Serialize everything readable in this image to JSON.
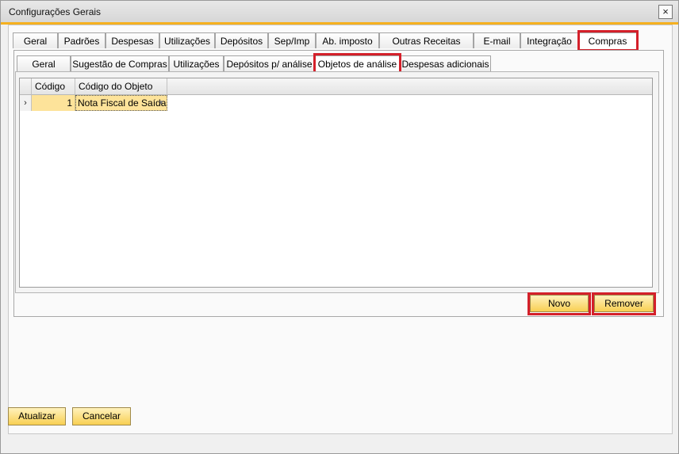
{
  "window": {
    "title": "Configurações Gerais",
    "close_label": "×"
  },
  "main_tabs": [
    {
      "label": "Geral"
    },
    {
      "label": "Padrões"
    },
    {
      "label": "Despesas"
    },
    {
      "label": "Utilizações"
    },
    {
      "label": "Depósitos"
    },
    {
      "label": "Sep/Imp"
    },
    {
      "label": "Ab. imposto"
    },
    {
      "label": "Outras Receitas"
    },
    {
      "label": "E-mail"
    },
    {
      "label": "Integração"
    },
    {
      "label": "Compras"
    }
  ],
  "main_tabs_selected": "Compras",
  "sub_tabs": [
    {
      "label": "Geral"
    },
    {
      "label": "Sugestão de Compras"
    },
    {
      "label": "Utilizações"
    },
    {
      "label": "Depósitos p/ análise"
    },
    {
      "label": "Objetos de análise"
    },
    {
      "label": "Despesas adicionais"
    }
  ],
  "sub_tabs_selected": "Objetos de análise",
  "table": {
    "columns": [
      "Código",
      "Código do Objeto"
    ],
    "rows": [
      {
        "row_marker": "›",
        "codigo": "1",
        "codigo_objeto": "Nota Fiscal de Saída"
      }
    ]
  },
  "panel_buttons": {
    "novo": "Novo",
    "remover": "Remover"
  },
  "footer_buttons": {
    "atualizar": "Atualizar",
    "cancelar": "Cancelar"
  },
  "colors": {
    "accent": "#f5b01f",
    "highlight_border": "#d4202a",
    "selected_cell": "#fde39a",
    "button_fill": "#f8cf52"
  }
}
